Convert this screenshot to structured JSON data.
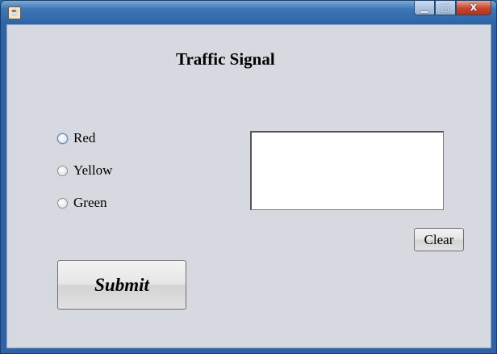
{
  "window": {
    "title": "",
    "controls": {
      "minimize": "▁",
      "maximize": "□",
      "close": "X"
    }
  },
  "main": {
    "heading": "Traffic Signal",
    "radio_options": [
      {
        "label": "Red",
        "selected": false,
        "focused": true
      },
      {
        "label": "Yellow",
        "selected": false,
        "focused": false
      },
      {
        "label": "Green",
        "selected": false,
        "focused": false
      }
    ],
    "output": {
      "value": ""
    },
    "clear_label": "Clear",
    "submit_label": "Submit"
  },
  "icons": {
    "app": "java-icon"
  }
}
